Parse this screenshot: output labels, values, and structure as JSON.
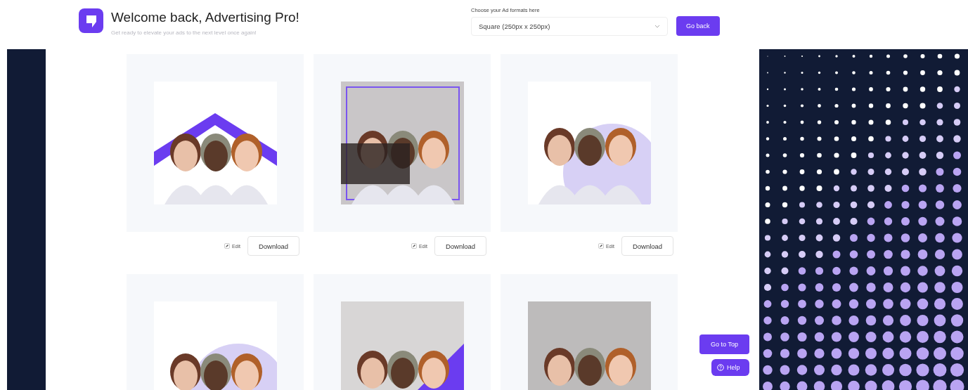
{
  "header": {
    "title": "Welcome back, Advertising Pro!",
    "subtitle": "Get ready to elevate your ads to the next level once again!"
  },
  "format_picker": {
    "label": "Choose your Ad formats here",
    "value": "Square (250px x 250px)"
  },
  "go_back_button": "Go back",
  "ads": [
    {
      "kind": "picture",
      "edit_label": "Edit",
      "download_label": "Download"
    },
    {
      "kind": "picture",
      "edit_label": "Edit",
      "download_label": "Download"
    },
    {
      "kind": "picture",
      "edit_label": "Edit",
      "download_label": "Download"
    },
    {
      "kind": "picture"
    },
    {
      "kind": "picture"
    },
    {
      "kind": "picture"
    }
  ],
  "go_to_top_button": "Go to Top",
  "help_button": "Help"
}
